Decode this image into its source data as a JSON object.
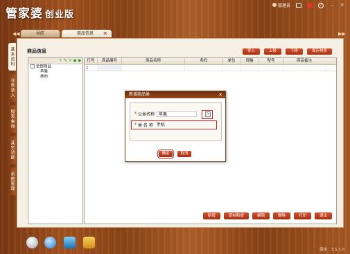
{
  "app": {
    "title_main": "管家婆",
    "title_sub": "创业版"
  },
  "topbar": {
    "user_label": "管理员",
    "help_label": "?",
    "minimize": "–",
    "close": "×"
  },
  "tabs": [
    {
      "label": "导航"
    },
    {
      "label": "商品信息"
    }
  ],
  "side_tabs": [
    "基本资料",
    "业务录入",
    "报表查询",
    "其它功能",
    "系统管理"
  ],
  "panel": {
    "title": "商品信息"
  },
  "header_buttons": [
    "导入",
    "上移",
    "下移",
    "保存排序"
  ],
  "tree": {
    "toolbar": [
      "+",
      "✎",
      "×",
      "◆",
      "◆"
    ],
    "root": "全部商品",
    "children": [
      "苹果",
      "美的"
    ]
  },
  "grid": {
    "columns": [
      "行号",
      "商品编号",
      "商品名称",
      "条码",
      "单位",
      "规格",
      "型号",
      "商品备注"
    ],
    "rows": [
      [
        "1",
        "",
        "",
        "",
        "",
        "",
        "",
        ""
      ]
    ]
  },
  "bottom_buttons": [
    "新增",
    "复制新增",
    "编辑",
    "删除",
    "打印",
    "退出"
  ],
  "dialog": {
    "title": "新增商品类",
    "parent_label": "父类名称",
    "parent_value": "苹果",
    "name_label": "类 名 称",
    "name_value": "手机",
    "confirm": "确定",
    "cancel": "取消"
  },
  "status": {
    "version": "版本：3.5.1.0"
  },
  "colors": {
    "accent": "#c0401a",
    "highlight": "#d0262a",
    "wood": "#a4531f"
  }
}
